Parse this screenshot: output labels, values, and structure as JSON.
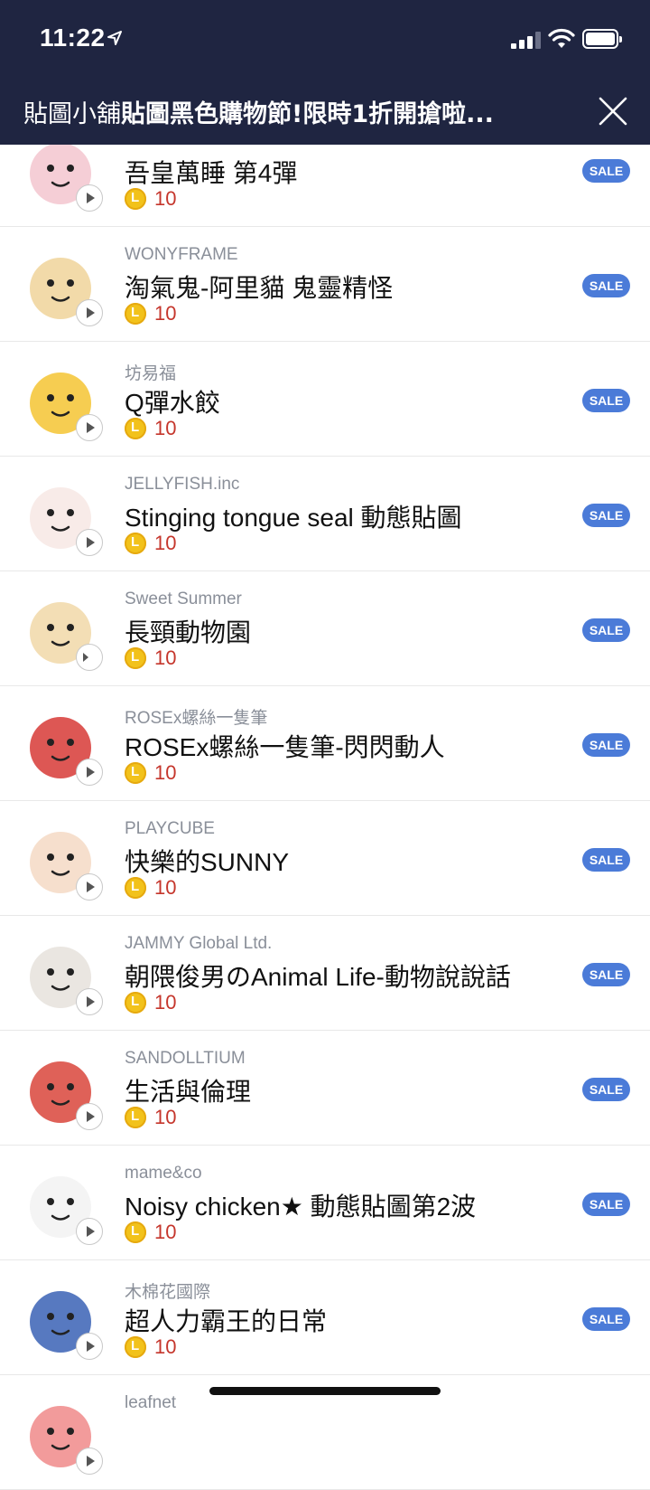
{
  "status_bar": {
    "time": "11:22"
  },
  "nav": {
    "title_prefix": "貼圖小舖",
    "title_main": "貼圖黑色購物節!限時1折開搶啦...",
    "close_icon": "close-icon"
  },
  "sale_label": "SALE",
  "items": [
    {
      "author": "",
      "title": "吾皇萬睡 第4彈",
      "price": "10",
      "sound": false,
      "thumb_color": "#f3c6cf"
    },
    {
      "author": "WONYFRAME",
      "title": "淘氣鬼-阿里貓 鬼靈精怪",
      "price": "10",
      "sound": false,
      "thumb_color": "#f0d39a"
    },
    {
      "author": "坊易福",
      "title": "Q彈水餃",
      "price": "10",
      "sound": false,
      "thumb_color": "#f5c433"
    },
    {
      "author": "JELLYFISH.inc",
      "title": "Stinging tongue seal 動態貼圖",
      "price": "10",
      "sound": false,
      "thumb_color": "#f7e8e4"
    },
    {
      "author": "Sweet Summer",
      "title": "長頸動物園",
      "price": "10",
      "sound": true,
      "thumb_color": "#f1d8a8"
    },
    {
      "author": "ROSEx螺絲一隻筆",
      "title": "ROSEx螺絲一隻筆-閃閃動人",
      "price": "10",
      "sound": false,
      "thumb_color": "#d73a36"
    },
    {
      "author": "PLAYCUBE",
      "title": "快樂的SUNNY",
      "price": "10",
      "sound": false,
      "thumb_color": "#f4d9c4"
    },
    {
      "author": "JAMMY Global Ltd.",
      "title": "朝隈俊男のAnimal Life-動物說說話",
      "price": "10",
      "sound": false,
      "thumb_color": "#e6e2dc"
    },
    {
      "author": "SANDOLLTIUM",
      "title": "生活與倫理",
      "price": "10",
      "sound": false,
      "thumb_color": "#d9453b"
    },
    {
      "author": "mame&co",
      "title": "Noisy chicken★ 動態貼圖第2波",
      "price": "10",
      "sound": false,
      "thumb_color": "#f2f2f2"
    },
    {
      "author": "木棉花國際",
      "title": "超人力霸王的日常",
      "price": "10",
      "sound": false,
      "thumb_color": "#3a62b5"
    },
    {
      "author": "leafnet",
      "title": "",
      "price": "",
      "sound": false,
      "thumb_color": "#f08a8a"
    }
  ]
}
